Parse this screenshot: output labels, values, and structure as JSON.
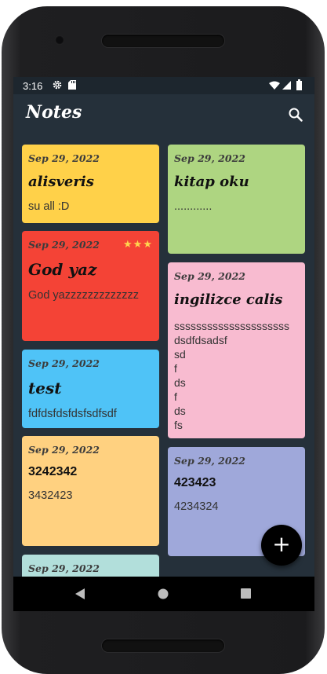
{
  "status_bar": {
    "time": "3:16",
    "icons": [
      "gear-icon",
      "sd-card-icon",
      "wifi-icon",
      "signal-icon",
      "battery-icon"
    ]
  },
  "app_bar": {
    "title": "Notes",
    "search_icon": "search-icon"
  },
  "notes": [
    {
      "date": "Sep 29, 2022",
      "title": "alisveris",
      "body": "su all :D",
      "color": "#ffd149"
    },
    {
      "date": "Sep 29, 2022",
      "title": "kitap oku",
      "body": "............",
      "color": "#aed581"
    },
    {
      "date": "Sep 29, 2022",
      "title": "God yaz",
      "body": "God yazzzzzzzzzzzzz",
      "color": "#f44336",
      "stars": "★★★"
    },
    {
      "date": "Sep 29, 2022",
      "title": "ingilizce calis",
      "body": "sssssssssssssssssssss\ndsdfdsadsf\nsd\nf\nds\nf\nds\nfs",
      "color": "#f8bbd0"
    },
    {
      "date": "Sep 29, 2022",
      "title": "test",
      "body": "fdfdsfdsfdsfsdfsdf",
      "color": "#4fc3f7"
    },
    {
      "date": "Sep 29, 2022",
      "title": "3242342",
      "body": "3432423",
      "color": "#ffd180"
    },
    {
      "date": "Sep 29, 2022",
      "title": "423423",
      "body": "4234324",
      "color": "#9fa8da"
    },
    {
      "date": "Sep 29, 2022",
      "title": "",
      "body": "",
      "color": "#b2dfdb"
    }
  ],
  "fab": {
    "label": "+",
    "icon": "add-icon"
  },
  "nav_bar": {
    "icons": [
      "back-icon",
      "home-icon",
      "recents-icon"
    ]
  }
}
